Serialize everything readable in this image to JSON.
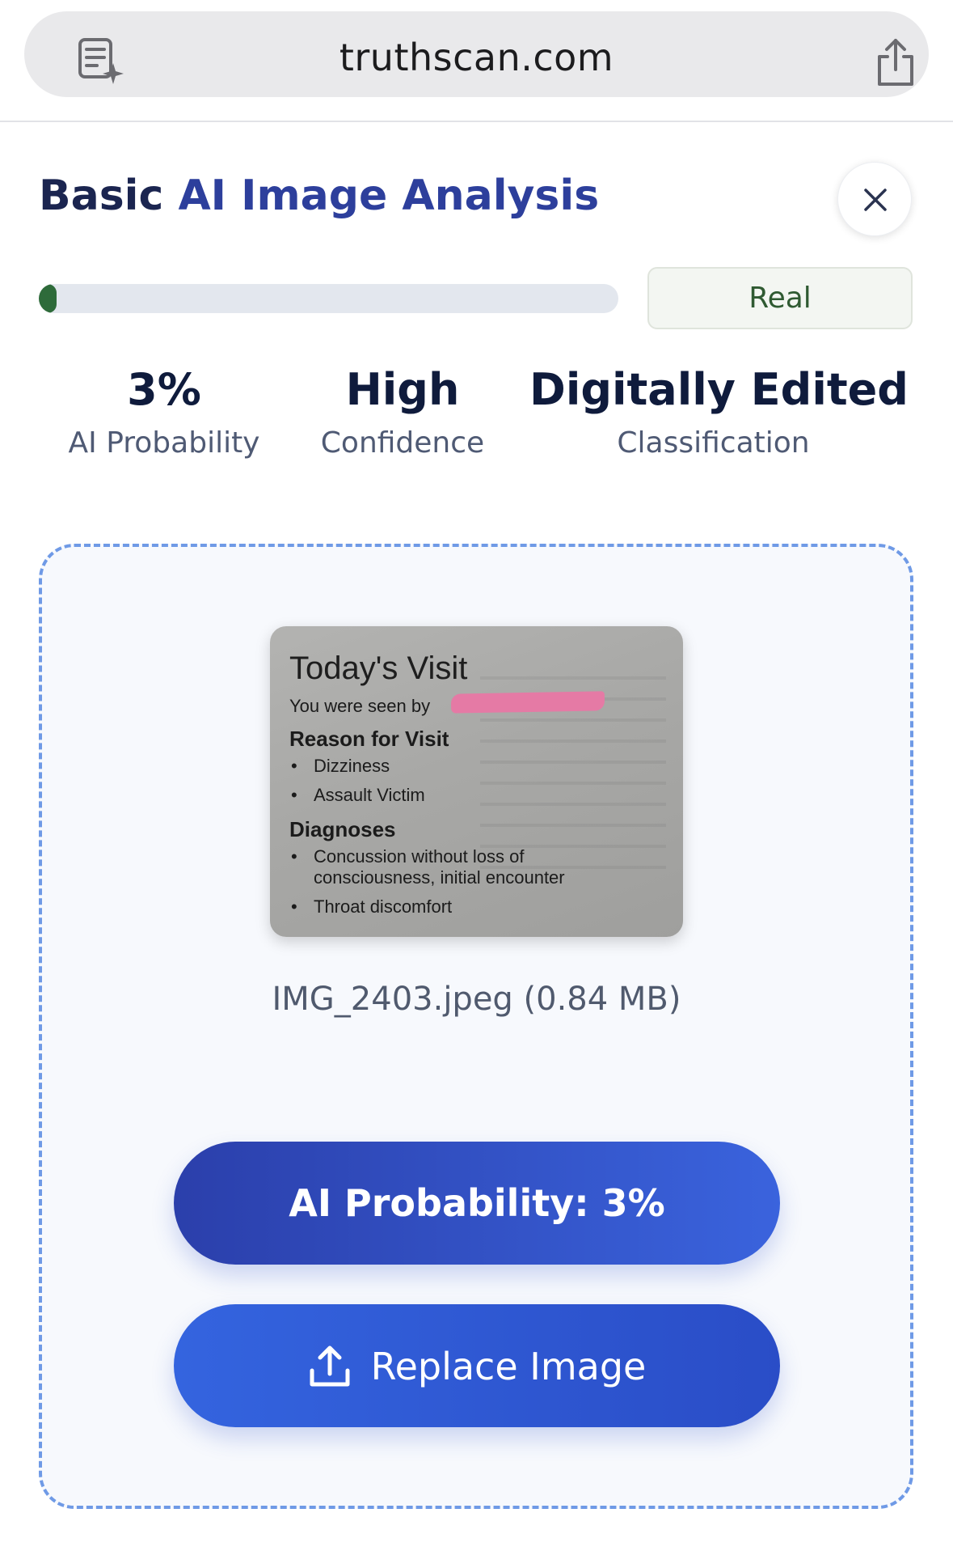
{
  "browser": {
    "url": "truthscan.com",
    "reader_icon": "reader-sparkle-icon",
    "share_icon": "share-icon"
  },
  "header": {
    "title_part1": "Basic",
    "title_part2": "AI Image Analysis",
    "close_icon": "close-icon"
  },
  "result": {
    "ai_probability": 0.03,
    "verdict": "Real",
    "colors": {
      "bar_fill": "#2e6b3a",
      "bar_track": "#e3e7ee",
      "accent": "#2d3f9c"
    }
  },
  "stats": [
    {
      "value": "3%",
      "label": "AI Probability"
    },
    {
      "value": "High",
      "label": "Confidence"
    },
    {
      "value": "Digitally Edited",
      "label": "Classification"
    }
  ],
  "upload": {
    "preview": {
      "heading": "Today's Visit",
      "seen_by": "You were seen by",
      "reason_title": "Reason for Visit",
      "reasons": [
        "Dizziness",
        "Assault Victim"
      ],
      "diagnoses_title": "Diagnoses",
      "diagnoses_line1": "Concussion without loss of",
      "diagnoses_line1_cont": "consciousness, initial encounter",
      "diagnoses_line2": "Throat discomfort"
    },
    "filename": "IMG_2403.jpeg (0.84 MB)",
    "probability_button": "AI Probability: 3%",
    "replace_button": "Replace Image",
    "upload_icon": "upload-icon"
  }
}
